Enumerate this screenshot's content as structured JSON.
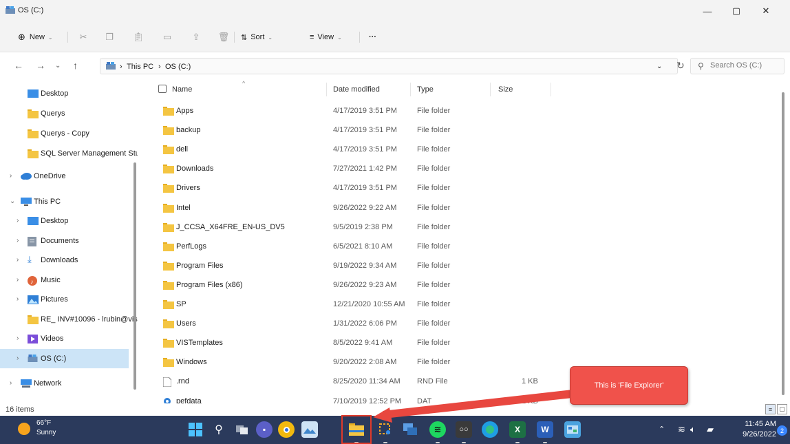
{
  "window": {
    "title": "OS (C:)",
    "controls": {
      "minimize": "—",
      "maximize": "▢",
      "close": "✕"
    }
  },
  "toolbar": {
    "new_label": "New",
    "sort_label": "Sort",
    "view_label": "View",
    "more_label": "···"
  },
  "address": {
    "crumbs": [
      "This PC",
      "OS (C:)"
    ],
    "search_placeholder": "Search OS (C:)"
  },
  "nav": {
    "items": [
      {
        "label": "Desktop",
        "icon": "desktop-icon",
        "chevron": ""
      },
      {
        "label": "Querys",
        "icon": "folder-icon",
        "chevron": ""
      },
      {
        "label": "Querys - Copy",
        "icon": "folder-icon",
        "chevron": ""
      },
      {
        "label": "SQL Server Management Stu",
        "icon": "folder-icon",
        "chevron": ""
      },
      {
        "label": "OneDrive",
        "icon": "cloud-icon",
        "chevron": ">"
      },
      {
        "label": "This PC",
        "icon": "pc-icon",
        "chevron": "v"
      },
      {
        "label": "Desktop",
        "icon": "desktop-icon",
        "chevron": ">"
      },
      {
        "label": "Documents",
        "icon": "document-icon",
        "chevron": ">"
      },
      {
        "label": "Downloads",
        "icon": "download-icon",
        "chevron": ">"
      },
      {
        "label": "Music",
        "icon": "music-icon",
        "chevron": ">"
      },
      {
        "label": "Pictures",
        "icon": "pictures-icon",
        "chevron": ">"
      },
      {
        "label": "RE_ INV#10096 - lrubin@vis",
        "icon": "folder-icon",
        "chevron": ""
      },
      {
        "label": "Videos",
        "icon": "video-icon",
        "chevron": ">"
      },
      {
        "label": "OS (C:)",
        "icon": "drive-icon",
        "chevron": ">"
      },
      {
        "label": "Network",
        "icon": "network-icon",
        "chevron": ">"
      }
    ]
  },
  "columns": {
    "name": "Name",
    "date": "Date modified",
    "type": "Type",
    "size": "Size"
  },
  "files": [
    {
      "name": "Apps",
      "date": "4/17/2019 3:51 PM",
      "type": "File folder",
      "size": ""
    },
    {
      "name": "backup",
      "date": "4/17/2019 3:51 PM",
      "type": "File folder",
      "size": ""
    },
    {
      "name": "dell",
      "date": "4/17/2019 3:51 PM",
      "type": "File folder",
      "size": ""
    },
    {
      "name": "Downloads",
      "date": "7/27/2021 1:42 PM",
      "type": "File folder",
      "size": ""
    },
    {
      "name": "Drivers",
      "date": "4/17/2019 3:51 PM",
      "type": "File folder",
      "size": ""
    },
    {
      "name": "Intel",
      "date": "9/26/2022 9:22 AM",
      "type": "File folder",
      "size": ""
    },
    {
      "name": "J_CCSA_X64FRE_EN-US_DV5",
      "date": "9/5/2019 2:38 PM",
      "type": "File folder",
      "size": ""
    },
    {
      "name": "PerfLogs",
      "date": "6/5/2021 8:10 AM",
      "type": "File folder",
      "size": ""
    },
    {
      "name": "Program Files",
      "date": "9/19/2022 9:34 AM",
      "type": "File folder",
      "size": ""
    },
    {
      "name": "Program Files (x86)",
      "date": "9/26/2022 9:23 AM",
      "type": "File folder",
      "size": ""
    },
    {
      "name": "SP",
      "date": "12/21/2020 10:55 AM",
      "type": "File folder",
      "size": ""
    },
    {
      "name": "Users",
      "date": "1/31/2022 6:06 PM",
      "type": "File folder",
      "size": ""
    },
    {
      "name": "VISTemplates",
      "date": "8/5/2022 9:41 AM",
      "type": "File folder",
      "size": ""
    },
    {
      "name": "Windows",
      "date": "9/20/2022 2:08 AM",
      "type": "File folder",
      "size": ""
    },
    {
      "name": ".rnd",
      "date": "8/25/2020 11:34 AM",
      "type": "RND File",
      "size": "1 KB"
    },
    {
      "name": "pefdata",
      "date": "7/10/2019 12:52 PM",
      "type": "DAT",
      "size": "1 KB"
    }
  ],
  "status": {
    "item_count": "16 items"
  },
  "taskbar": {
    "weather_temp": "66°F",
    "weather_desc": "Sunny",
    "time": "11:45 AM",
    "date": "9/26/2022",
    "notifications": "2"
  },
  "annotation": {
    "text": "This is 'File Explorer'"
  },
  "colors": {
    "accent_selected": "#cce4f7",
    "taskbar": "#2b3a5c",
    "callout": "#f0524b",
    "folder": "#f4c542"
  }
}
